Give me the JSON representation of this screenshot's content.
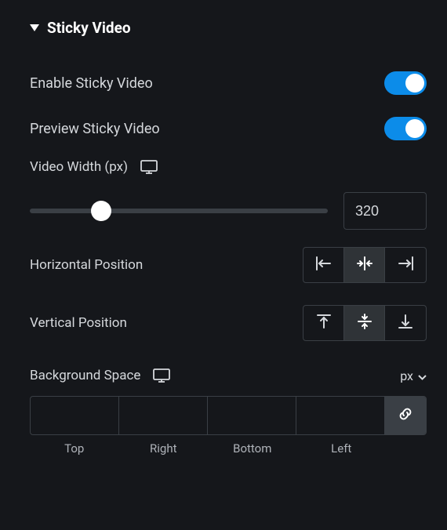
{
  "section": {
    "title": "Sticky Video"
  },
  "enable": {
    "label": "Enable Sticky Video",
    "value": true
  },
  "preview": {
    "label": "Preview Sticky Video",
    "value": true
  },
  "width": {
    "label": "Video Width (px)",
    "value": "320"
  },
  "hpos": {
    "label": "Horizontal Position",
    "selected": "center"
  },
  "vpos": {
    "label": "Vertical Position",
    "selected": "middle"
  },
  "bgspace": {
    "label": "Background Space",
    "unit": "px",
    "sides": {
      "top": "Top",
      "right": "Right",
      "bottom": "Bottom",
      "left": "Left"
    },
    "values": {
      "top": "",
      "right": "",
      "bottom": "",
      "left": ""
    }
  }
}
